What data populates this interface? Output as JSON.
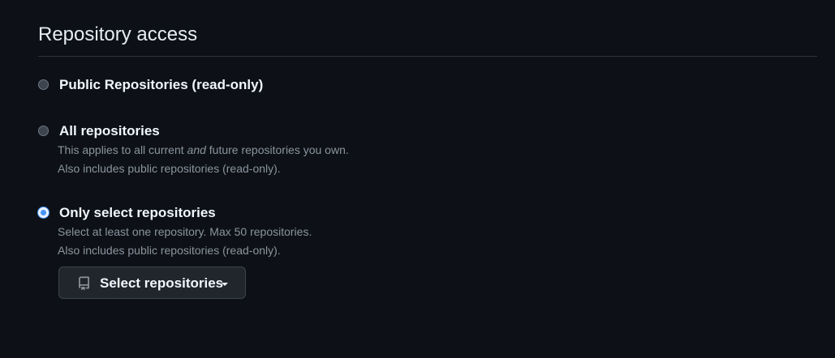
{
  "section": {
    "title": "Repository access"
  },
  "options": [
    {
      "label": "Public Repositories (read-only)",
      "checked": false
    },
    {
      "label": "All repositories",
      "checked": false,
      "note_line1_pre": "This applies to all current ",
      "note_line1_em": "and",
      "note_line1_post": " future repositories you own.",
      "note_line2": "Also includes public repositories (read-only)."
    },
    {
      "label": "Only select repositories",
      "checked": true,
      "note_line1": "Select at least one repository. Max 50 repositories.",
      "note_line2": "Also includes public repositories (read-only)."
    }
  ],
  "select_button": {
    "label": "Select repositories",
    "icon": "repo-icon",
    "caret": "triangle-down-icon"
  },
  "colors": {
    "background": "#0d1117",
    "text": "#e6edf3",
    "muted": "#8b949e",
    "accent": "#4493f8",
    "divider": "#30363d",
    "button_bg": "#21262d"
  }
}
